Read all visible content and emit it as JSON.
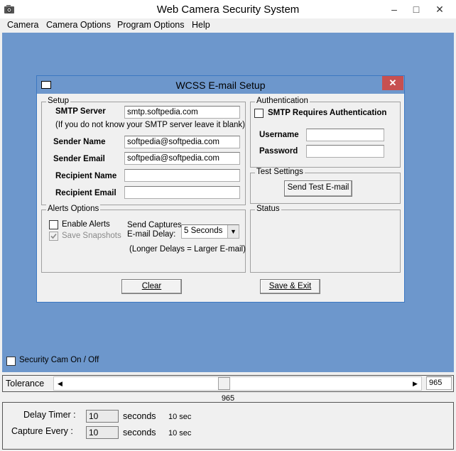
{
  "window": {
    "title": "Web Camera Security System",
    "minimize": "–",
    "maximize": "□",
    "close": "✕"
  },
  "menu": [
    "Camera",
    "Camera Options",
    "Program Options",
    "Help"
  ],
  "dialog": {
    "title": "WCSS E-mail Setup",
    "close": "✕",
    "setup": {
      "group_label": "Setup",
      "smtp_label": "SMTP Server",
      "smtp_value": "smtp.softpedia.com",
      "smtp_hint": "(If you do not know your SMTP server leave it blank)",
      "sender_name_label": "Sender Name",
      "sender_name_value": "softpedia@softpedia.com",
      "sender_email_label": "Sender Email",
      "sender_email_value": "softpedia@softpedia.com",
      "recipient_name_label": "Recipient Name",
      "recipient_name_value": "",
      "recipient_email_label": "Recipient Email",
      "recipient_email_value": ""
    },
    "auth": {
      "group_label": "Authentication",
      "requires_auth_label": "SMTP Requires Authentication",
      "username_label": "Username",
      "username_value": "",
      "password_label": "Password",
      "password_value": ""
    },
    "test": {
      "group_label": "Test Settings",
      "send_test_label": "Send Test E-mail"
    },
    "alerts": {
      "group_label": "Alerts Options",
      "enable_alerts_label": "Enable Alerts",
      "save_snapshots_label": "Save Snapshots",
      "send_captures_label_1": "Send Captures",
      "send_captures_label_2": "E-mail Delay:",
      "delay_value": "5 Seconds",
      "delay_note": "(Longer Delays = Larger E-mail)"
    },
    "status": {
      "group_label": "Status"
    },
    "clear_label": "Clear",
    "save_exit_label": "Save & Exit"
  },
  "security_cam_label": "Security Cam On / Off",
  "tolerance": {
    "label": "Tolerance",
    "value_box": "965",
    "value_readout": "965",
    "slider_fraction": 0.46
  },
  "bottom": {
    "delay_timer_label": "Delay Timer :",
    "delay_timer_value": "10",
    "delay_timer_unit": "seconds",
    "delay_timer_readout": "10 sec",
    "capture_every_label": "Capture Every :",
    "capture_every_value": "10",
    "capture_every_unit": "seconds",
    "capture_every_readout": "10 sec"
  }
}
